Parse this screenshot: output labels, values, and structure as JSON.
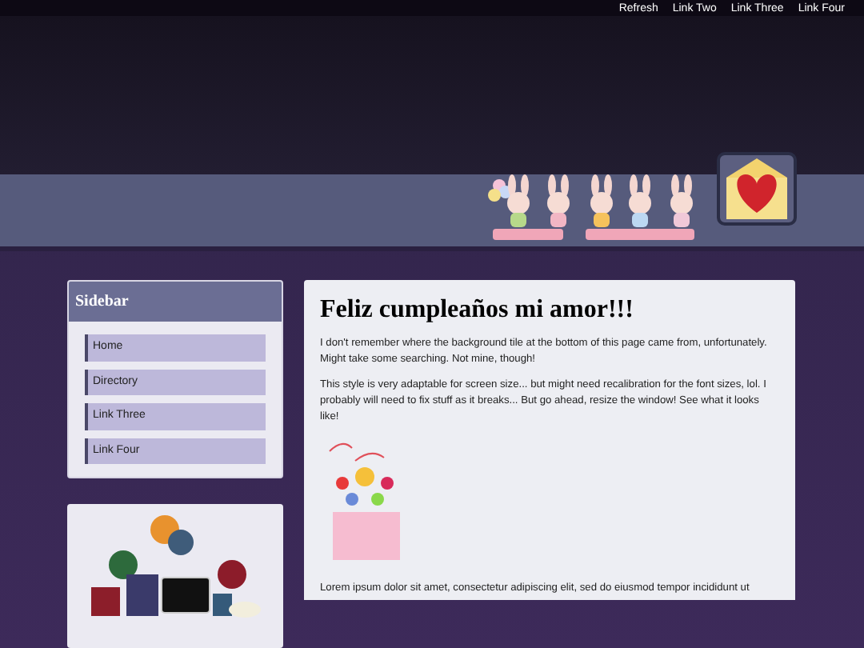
{
  "nav": {
    "links": [
      "Refresh",
      "Link Two",
      "Link Three",
      "Link Four"
    ]
  },
  "sidebar": {
    "title": "Sidebar",
    "links": [
      "Home",
      "Directory",
      "Link Three",
      "Link Four"
    ]
  },
  "content": {
    "title": "Feliz cumpleaños mi amor!!!",
    "paragraphs": [
      "I don't remember where the background tile at the bottom of this page came from, unfortunately. Might take some searching. Not mine, though!",
      "This style is very adaptable for screen size... but might need recalibration for the font sizes, lol. I probably will need to fix stuff as it breaks... But go ahead, resize the window! See what it looks like!"
    ],
    "footer_paragraph": "Lorem ipsum dolor sit amet, consectetur adipiscing elit, sed do eiusmod tempor incididunt ut"
  }
}
